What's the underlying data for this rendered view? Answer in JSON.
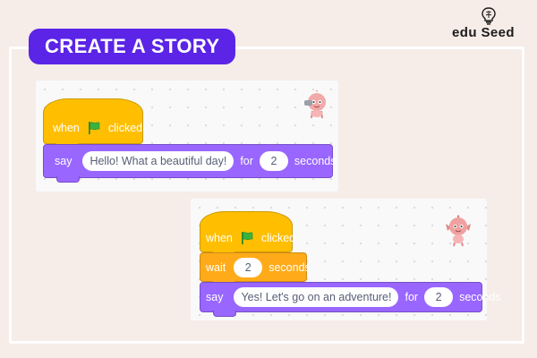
{
  "header": {
    "title": "CREATE A STORY"
  },
  "brand": {
    "name": "edu Seed",
    "icon": "lightbulb-brain-icon"
  },
  "colors": {
    "background": "#f6ece8",
    "title_pill": "#5b24e6",
    "events_block": "#ffbf00",
    "control_block": "#ffab19",
    "looks_block": "#9966ff",
    "flag": "#3bb33b"
  },
  "script1": {
    "hat": {
      "when": "when",
      "flag_icon": "green-flag-icon",
      "clicked": "clicked"
    },
    "say": {
      "say": "say",
      "message": "Hello! What a beautiful day!",
      "for": "for",
      "duration": "2",
      "seconds": "seconds"
    },
    "sprite_icon": "sprite-character-icon"
  },
  "script2": {
    "hat": {
      "when": "when",
      "flag_icon": "green-flag-icon",
      "clicked": "clicked"
    },
    "wait": {
      "wait": "wait",
      "duration": "2",
      "seconds": "seconds"
    },
    "say": {
      "say": "say",
      "message": "Yes! Let's go on an adventure!",
      "for": "for",
      "duration": "2",
      "seconds": "seconds"
    },
    "sprite_icon": "sprite-character-icon"
  }
}
